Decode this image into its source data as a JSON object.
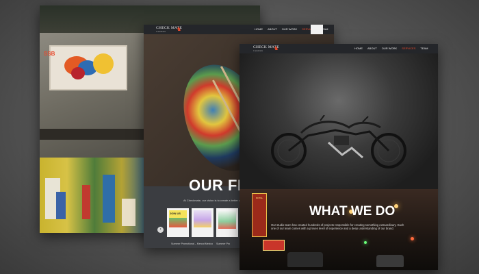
{
  "brand": {
    "name": "CHECK MATE",
    "tagline": "Consultants",
    "accent": "#e84a2d"
  },
  "nav": {
    "items": [
      "HOME",
      "ABOUT",
      "OUR WORK",
      "SERVICES",
      "TEAM"
    ],
    "active": "SERVICES"
  },
  "middle_page": {
    "heading": "OUR FEATU",
    "intro": "At Checkmate, our vision is to create a better wor",
    "cards": [
      {
        "title": "Summer Promotional – Mercat Mexico",
        "badge": "JOIN US"
      },
      {
        "title": "Summer Pro"
      }
    ]
  },
  "front_page": {
    "heading": "WHAT WE DO",
    "description": "Our studio team has created hundreds of projects responsible for creating something extraordinary. Each one of our team comes with a proven level of experience and a deep understanding of our brand.",
    "sign_text": "MOTEL"
  },
  "back_page": {
    "logo": "SSB"
  }
}
